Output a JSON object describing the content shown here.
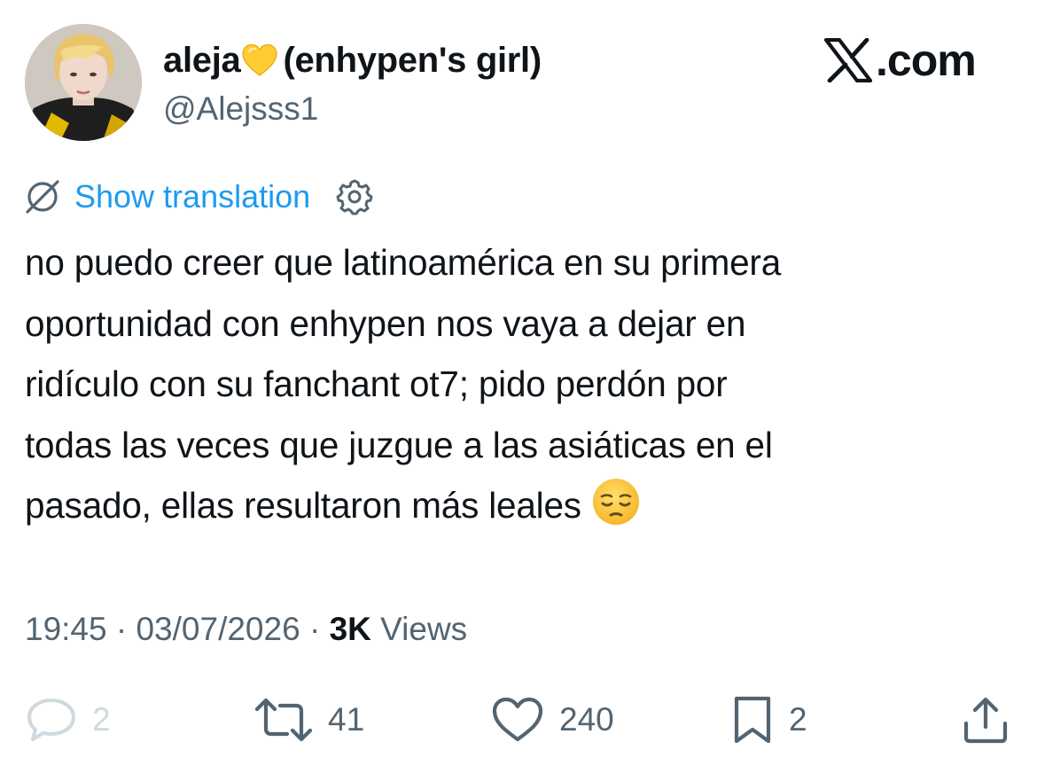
{
  "author": {
    "name": "aleja",
    "name_suffix": "(enhypen's girl)",
    "name_emoji": "yellow-heart-icon",
    "handle": "@Alejsss1"
  },
  "site_logo": ".com",
  "translation": {
    "label": "Show translation",
    "icon": "translate-off-icon",
    "settings_icon": "gear-icon"
  },
  "tweet": {
    "lines": [
      "no puedo creer que latinoamérica en su primera",
      "oportunidad con enhypen nos vaya a dejar en",
      "ridículo con su fanchant ot7; pido perdón por",
      "todas las veces que juzgue a las asiáticas en el",
      "pasado, ellas resultaron más leales"
    ],
    "trailing_emoji": "pensive-face-icon"
  },
  "meta": {
    "time": "19:45",
    "separator": " · ",
    "date": "03/07/2026",
    "views_count": "3K",
    "views_label": "Views"
  },
  "actions": {
    "replies": "2",
    "retweets": "41",
    "likes": "240",
    "bookmarks": "2"
  },
  "colors": {
    "accent": "#1d9bf0",
    "secondary_text": "#536471",
    "primary_text": "#0f1419"
  }
}
